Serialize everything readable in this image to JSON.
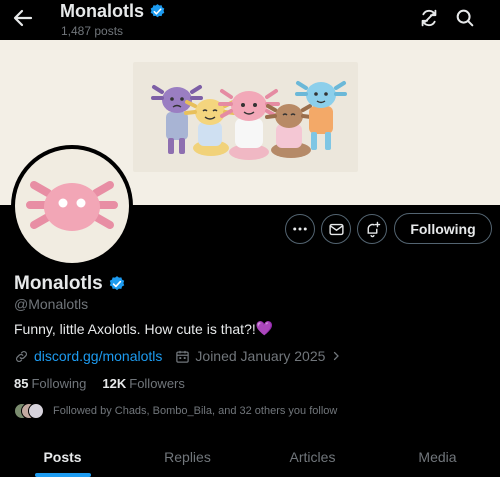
{
  "header": {
    "title": "Monalotls",
    "posts_count": "1,487 posts"
  },
  "profile": {
    "display_name": "Monalotls",
    "handle": "@Monalotls",
    "bio": "Funny, little Axolotls. How cute is that?!",
    "bio_emoji": "💜",
    "link": "discord.gg/monalotls",
    "joined": "Joined January 2025",
    "following_count": "85",
    "following_label": "Following",
    "followers_count": "12K",
    "followers_label": "Followers",
    "followed_by": "Followed by Chads, Bombo_Bila, and 32 others you follow"
  },
  "actions": {
    "follow_button": "Following"
  },
  "tabs": [
    {
      "label": "Posts",
      "active": true
    },
    {
      "label": "Replies",
      "active": false
    },
    {
      "label": "Articles",
      "active": false
    },
    {
      "label": "Media",
      "active": false
    }
  ],
  "icons": {
    "back": "arrow-left-icon",
    "refresh": "refresh-icon",
    "search": "search-icon",
    "more": "more-icon",
    "message": "envelope-icon",
    "notify": "bell-plus-icon",
    "verified": "verified-badge-icon",
    "link": "link-icon",
    "calendar": "calendar-icon"
  },
  "colors": {
    "accent": "#1d9bf0",
    "background": "#000000",
    "banner": "#f3efe6",
    "muted": "#71767b"
  }
}
